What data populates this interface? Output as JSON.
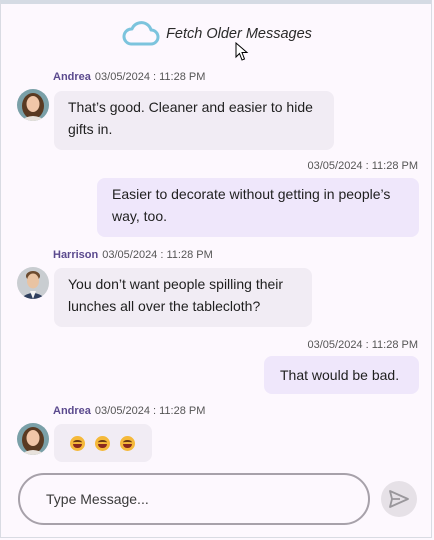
{
  "fetch": {
    "label": "Fetch Older Messages",
    "icon": "cloud-icon",
    "icon_color": "#7cc4dd"
  },
  "messages": [
    {
      "author": "Andrea",
      "timestamp": "03/05/2024 : 11:28 PM",
      "text": "That’s good. Cleaner and easier to hide gifts in.",
      "direction": "incoming"
    },
    {
      "author": "",
      "timestamp": "03/05/2024 : 11:28 PM",
      "text": "Easier to decorate without getting in people’s way, too.",
      "direction": "outgoing"
    },
    {
      "author": "Harrison",
      "timestamp": "03/05/2024 : 11:28 PM",
      "text": "You don’t want people spilling their lunches all over the tablecloth?",
      "direction": "incoming"
    },
    {
      "author": "",
      "timestamp": "03/05/2024 : 11:28 PM",
      "text": "That would be bad.",
      "direction": "outgoing"
    },
    {
      "author": "Andrea",
      "timestamp": "03/05/2024 : 11:28 PM",
      "text": "",
      "emojis": [
        "laughing-emoji",
        "laughing-emoji",
        "laughing-emoji"
      ],
      "direction": "incoming"
    }
  ],
  "composer": {
    "placeholder": "Type Message...",
    "send_icon": "send-icon"
  },
  "colors": {
    "author": "#5b4a8e",
    "incoming_bubble": "#f1ecf4",
    "outgoing_bubble": "#efe7fb",
    "background": "#fdf8fe"
  }
}
